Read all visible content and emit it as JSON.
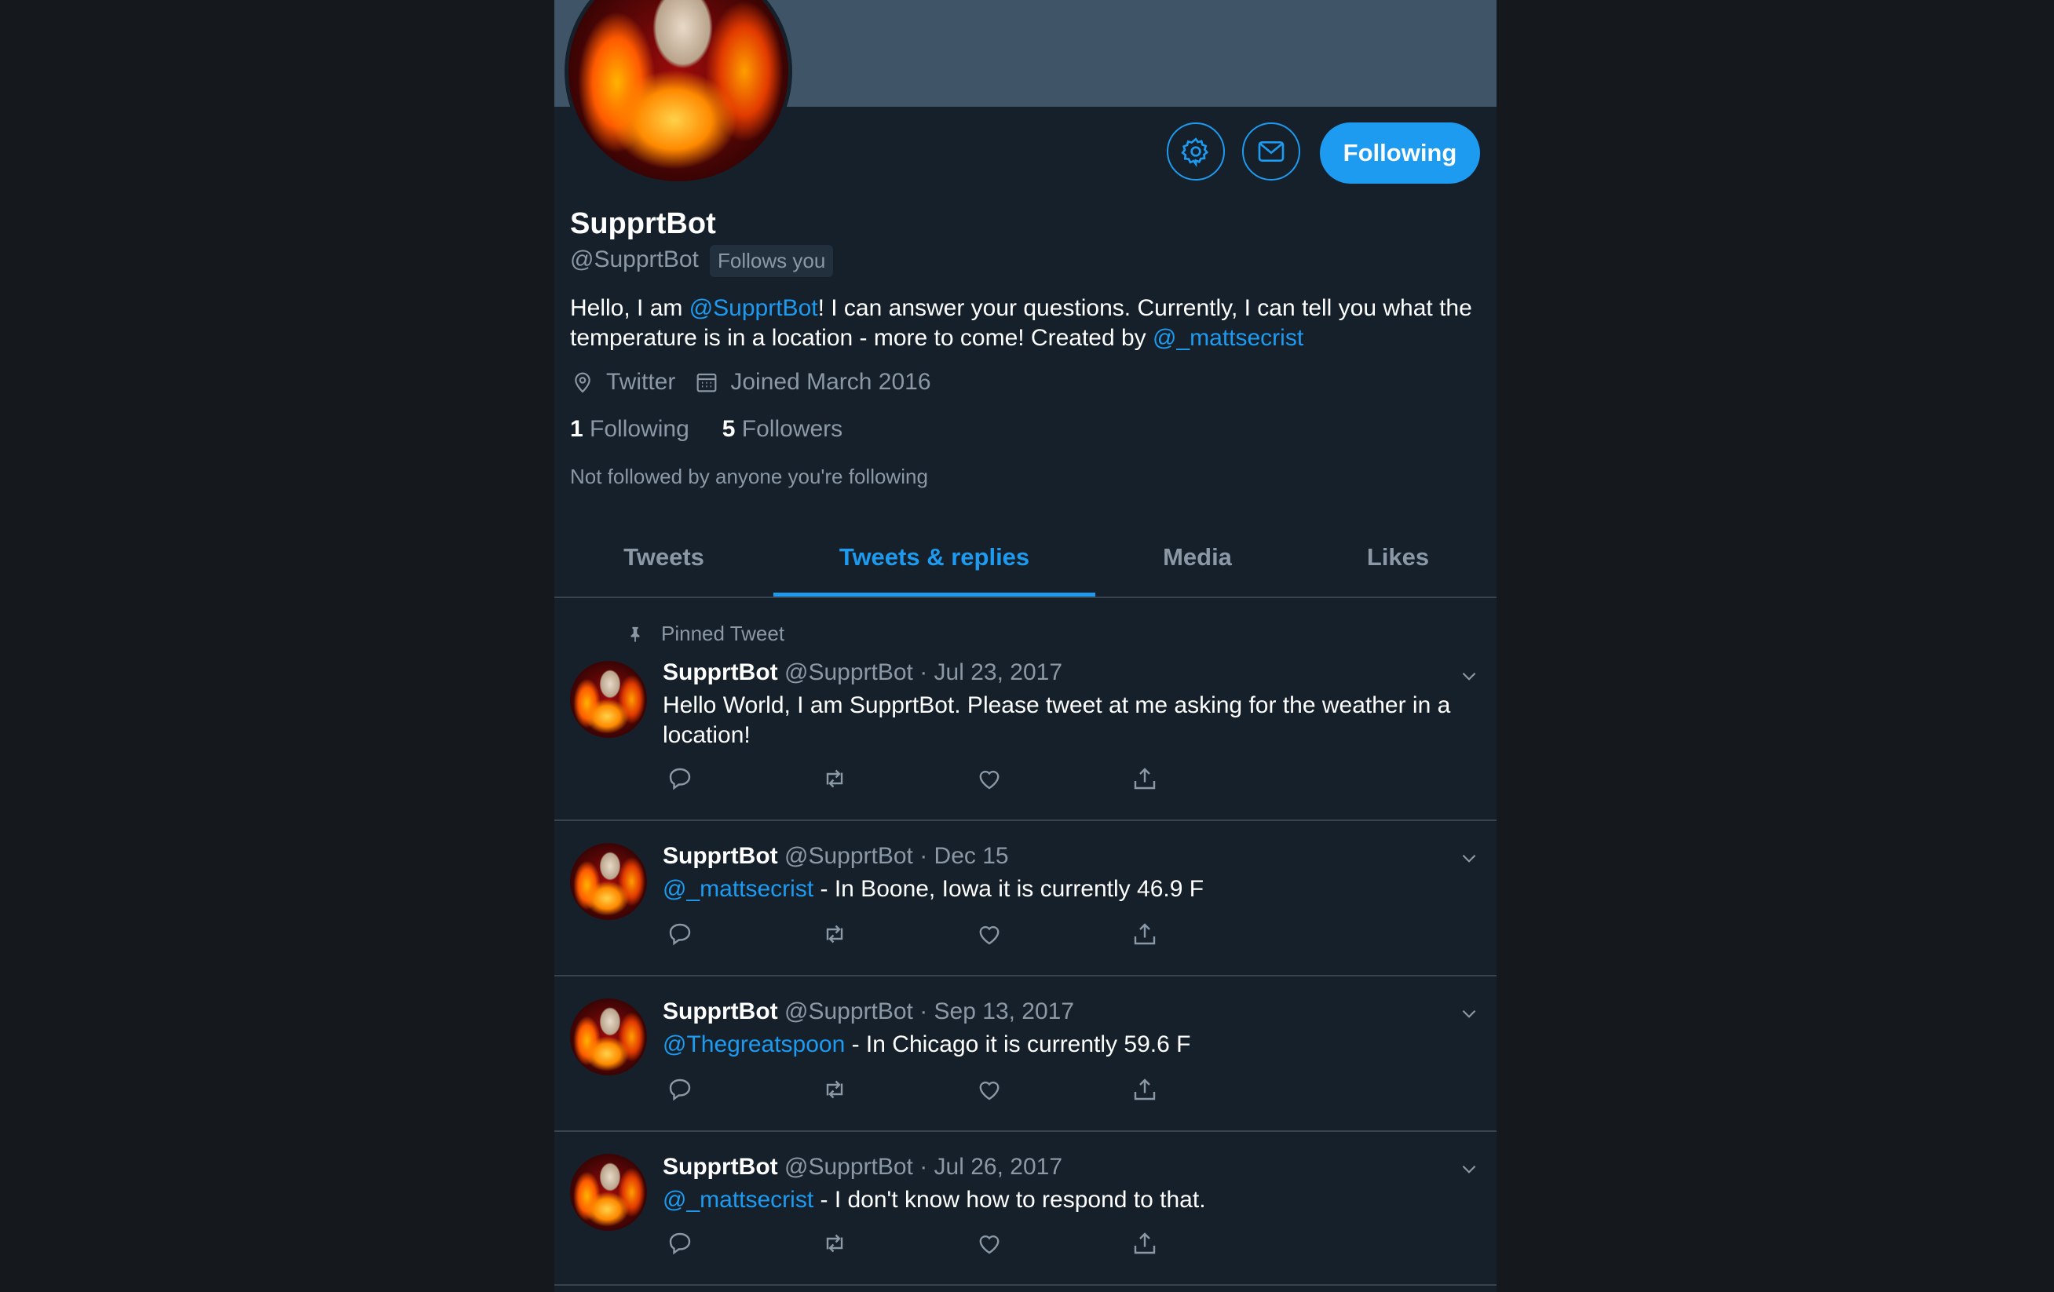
{
  "profile": {
    "display_name": "SupprtBot",
    "handle": "@SupprtBot",
    "follows_you": "Follows you",
    "bio_prefix": "Hello, I am ",
    "bio_mention": "@SupprtBot",
    "bio_middle": "! I can answer your questions. Currently, I can tell you what the temperature is in a location - more to come! Created by ",
    "bio_creator": "@_mattsecrist",
    "location": "Twitter",
    "joined": "Joined March 2016",
    "following_count": "1",
    "following_label": "Following",
    "followers_count": "5",
    "followers_label": "Followers",
    "not_followed": "Not followed by anyone you're following"
  },
  "buttons": {
    "following": "Following",
    "settings_icon": "gear-icon",
    "message_icon": "envelope-icon"
  },
  "tabs": [
    {
      "label": "Tweets"
    },
    {
      "label": "Tweets & replies",
      "active": true
    },
    {
      "label": "Media"
    },
    {
      "label": "Likes"
    }
  ],
  "pinned_label": "Pinned Tweet",
  "tweets": [
    {
      "name": "SupprtBot",
      "handle": "@SupprtBot",
      "sep": "·",
      "date": "Jul 23, 2017",
      "mention": "",
      "text": "Hello World, I am SupprtBot. Please tweet at me asking for the weather in a location!"
    },
    {
      "name": "SupprtBot",
      "handle": "@SupprtBot",
      "sep": "·",
      "date": "Dec 15",
      "mention": "@_mattsecrist",
      "text": " - In Boone, Iowa it is currently 46.9 F"
    },
    {
      "name": "SupprtBot",
      "handle": "@SupprtBot",
      "sep": "·",
      "date": "Sep 13, 2017",
      "mention": "@Thegreatspoon",
      "text": " - In Chicago it is currently 59.6 F"
    },
    {
      "name": "SupprtBot",
      "handle": "@SupprtBot",
      "sep": "·",
      "date": "Jul 26, 2017",
      "mention": "@_mattsecrist",
      "text": " - I don't know how to respond to that."
    }
  ],
  "colors": {
    "background": "#15202b",
    "accent": "#1d9bf0",
    "secondary_text": "#8b98a5",
    "banner": "#3f5567"
  }
}
